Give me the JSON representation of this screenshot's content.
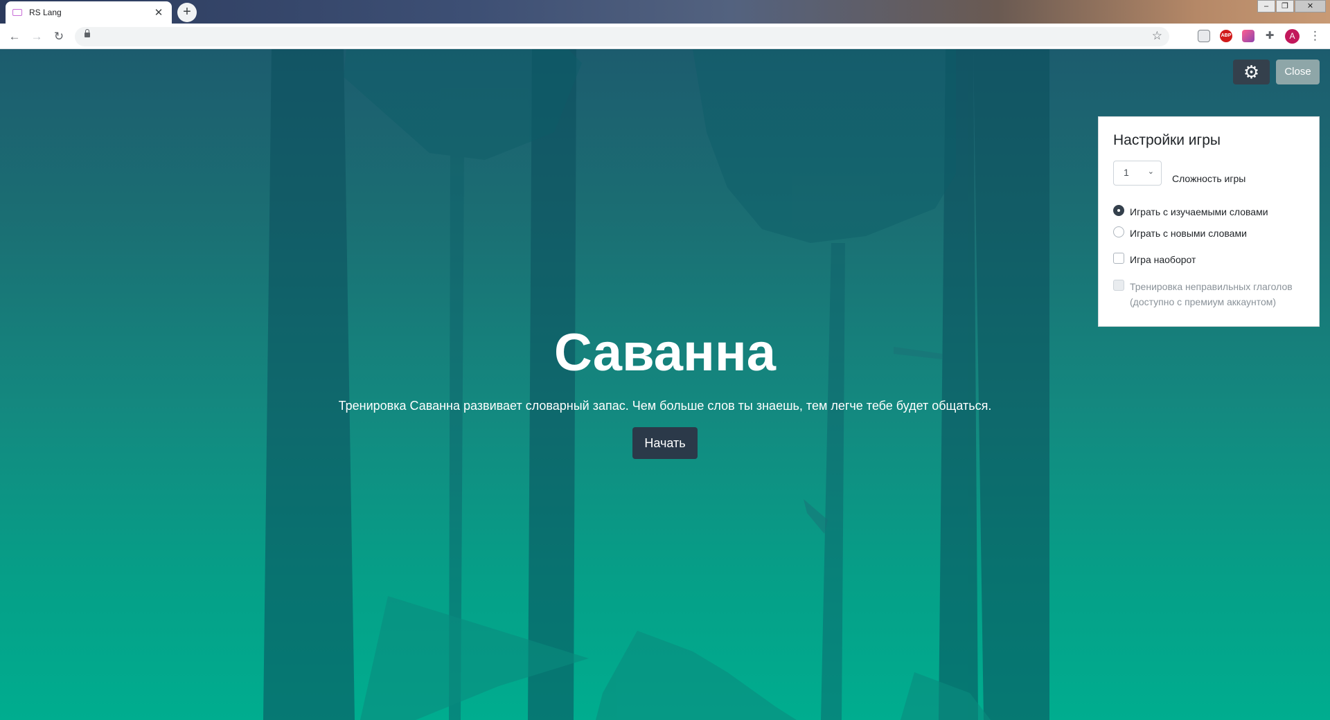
{
  "browser": {
    "tab_title": "RS Lang",
    "tab_close_glyph": "✕",
    "new_tab_glyph": "+",
    "window_controls": [
      "–",
      "❐",
      "✕"
    ],
    "nav_back": "←",
    "nav_forward": "→",
    "nav_reload": "↻",
    "bookmark_star": "☆",
    "ext_abp_label": "ABP",
    "profile_initial": "A",
    "menu_glyph": "⋮"
  },
  "game": {
    "settings_glyph": "⚙",
    "close_label": "Close",
    "title": "Саванна",
    "description": "Тренировка Саванна развивает словарный запас. Чем больше слов ты знаешь, тем легче тебе будет общаться.",
    "start_label": "Начать"
  },
  "settings": {
    "heading": "Настройки игры",
    "difficulty_value": "1",
    "difficulty_label": "Сложность игры",
    "options": [
      {
        "label": "Играть с изучаемыми словами",
        "type": "radio",
        "checked": true
      },
      {
        "label": "Играть с новыми словами",
        "type": "radio",
        "checked": false
      },
      {
        "label": "Игра наоборот",
        "type": "checkbox",
        "checked": false
      },
      {
        "label": "Тренировка неправильных глаголов (доступно с премиум аккаунтом)",
        "type": "checkbox",
        "checked": false,
        "disabled": true
      }
    ]
  },
  "colors": {
    "accent_dark": "#34404c",
    "start_button": "#2b3949",
    "close_button": "#8ea6a8",
    "profile_avatar": "#c2185b"
  }
}
